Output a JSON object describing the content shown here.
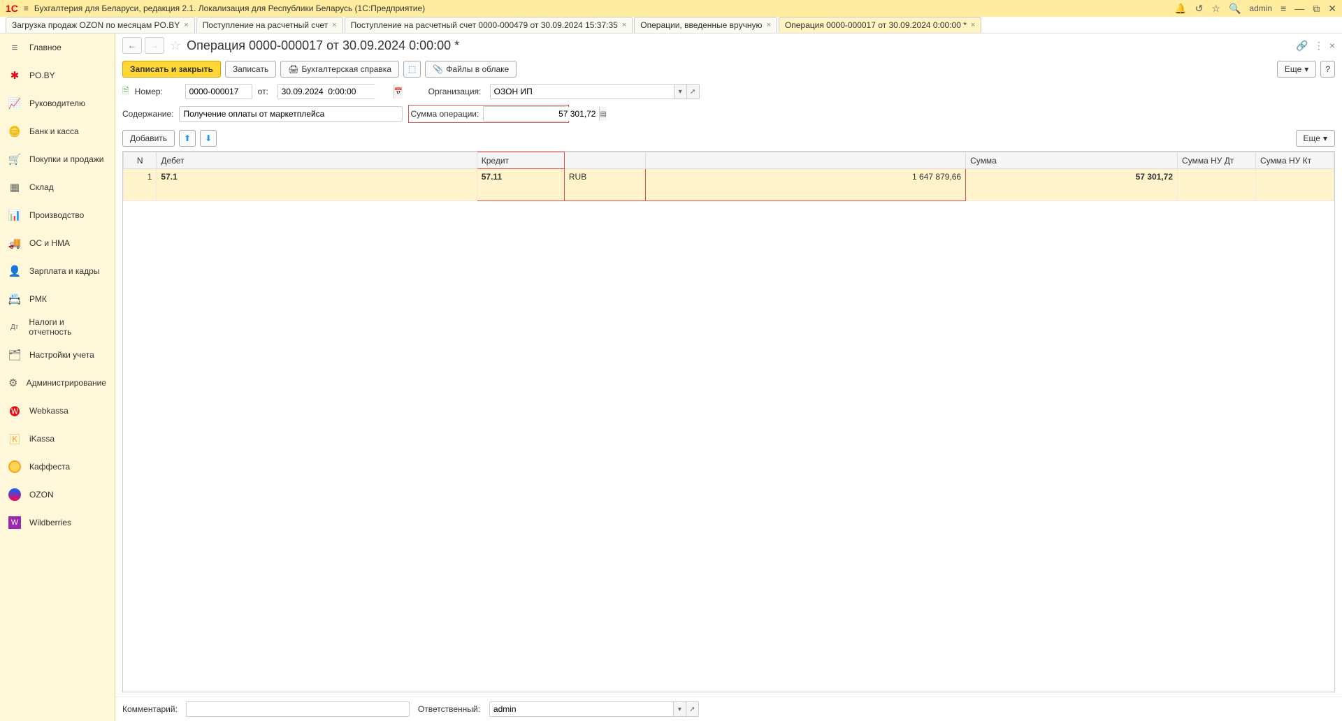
{
  "titlebar": {
    "app_title": "Бухгалтерия для Беларуси, редакция 2.1. Локализация для Республики Беларусь   (1С:Предприятие)",
    "user": "admin"
  },
  "tabs": [
    {
      "label": "Загрузка продаж OZON по месяцам PO.BY"
    },
    {
      "label": "Поступление на расчетный счет"
    },
    {
      "label": "Поступление на расчетный счет 0000-000479 от 30.09.2024 15:37:35"
    },
    {
      "label": "Операции, введенные вручную"
    },
    {
      "label": "Операция 0000-000017 от 30.09.2024 0:00:00 *",
      "active": true
    }
  ],
  "sidebar": [
    {
      "label": "Главное",
      "icon": "≡"
    },
    {
      "label": "PO.BY",
      "icon": "✱"
    },
    {
      "label": "Руководителю",
      "icon": "📈"
    },
    {
      "label": "Банк и касса",
      "icon": "🪙"
    },
    {
      "label": "Покупки и продажи",
      "icon": "🛒"
    },
    {
      "label": "Склад",
      "icon": "▦"
    },
    {
      "label": "Производство",
      "icon": "📊"
    },
    {
      "label": "ОС и НМА",
      "icon": "🚚"
    },
    {
      "label": "Зарплата и кадры",
      "icon": "👤"
    },
    {
      "label": "РМК",
      "icon": "📇"
    },
    {
      "label": "Налоги и отчетность",
      "icon": "Дт"
    },
    {
      "label": "Настройки учета",
      "icon": "🗂"
    },
    {
      "label": "Администрирование",
      "icon": "⚙"
    },
    {
      "label": "Webkassa",
      "icon": "🅦"
    },
    {
      "label": "iKassa",
      "icon": "🄺"
    },
    {
      "label": "Каффеста",
      "icon": "●"
    },
    {
      "label": "OZON",
      "icon": "●"
    },
    {
      "label": "Wildberries",
      "icon": "W"
    }
  ],
  "page": {
    "title": "Операция 0000-000017 от 30.09.2024 0:00:00 *"
  },
  "toolbar": {
    "save_close": "Записать и закрыть",
    "save": "Записать",
    "acct_report": "Бухгалтерская справка",
    "files_cloud": "Файлы в облаке",
    "more": "Еще",
    "help": "?"
  },
  "form": {
    "number_label": "Номер:",
    "number": "0000-000017",
    "from_label": "от:",
    "from": "30.09.2024  0:00:00",
    "org_label": "Организация:",
    "org": "ОЗОН ИП",
    "content_label": "Содержание:",
    "content": "Получение оплаты от маркетплейса",
    "sum_label": "Сумма операции:",
    "sum": "57 301,72"
  },
  "subtoolbar": {
    "add": "Добавить",
    "more": "Еще"
  },
  "table": {
    "headers": {
      "n": "N",
      "debit": "Дебет",
      "credit": "Кредит",
      "credit_cur": "",
      "credit_amt": "",
      "sum": "Сумма",
      "sum_nu_dt": "Сумма НУ Дт",
      "sum_nu_kt": "Сумма НУ Кт"
    },
    "rows": [
      {
        "n": "1",
        "debit": "57.1",
        "credit": "57.11",
        "credit_cur": "RUB",
        "credit_amt": "1 647 879,66",
        "sum": "57 301,72",
        "sum_nu_dt": "",
        "sum_nu_kt": ""
      }
    ]
  },
  "footer": {
    "comment_label": "Комментарий:",
    "comment": "",
    "responsible_label": "Ответственный:",
    "responsible": "admin"
  }
}
